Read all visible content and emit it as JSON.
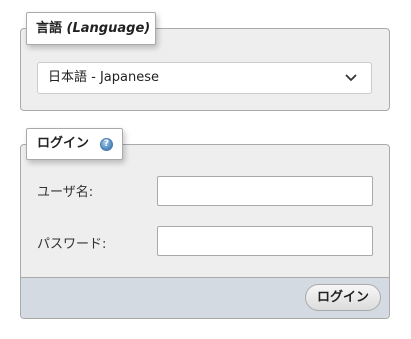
{
  "language_section": {
    "legend_label": "言語",
    "legend_label_en": "(Language)",
    "selected_language": "日本語 - Japanese"
  },
  "login_section": {
    "legend_label": "ログイン",
    "help_icon_glyph": "?",
    "username_label": "ユーザ名:",
    "username_value": "",
    "password_label": "パスワード:",
    "password_value": "",
    "submit_label": "ログイン"
  },
  "icons": {
    "dropdown": "chevron-down-icon",
    "help": "help-icon"
  },
  "colors": {
    "panel_background": "#eeeeee",
    "footer_background": "#d3dae2",
    "border": "#aaaaaa"
  }
}
